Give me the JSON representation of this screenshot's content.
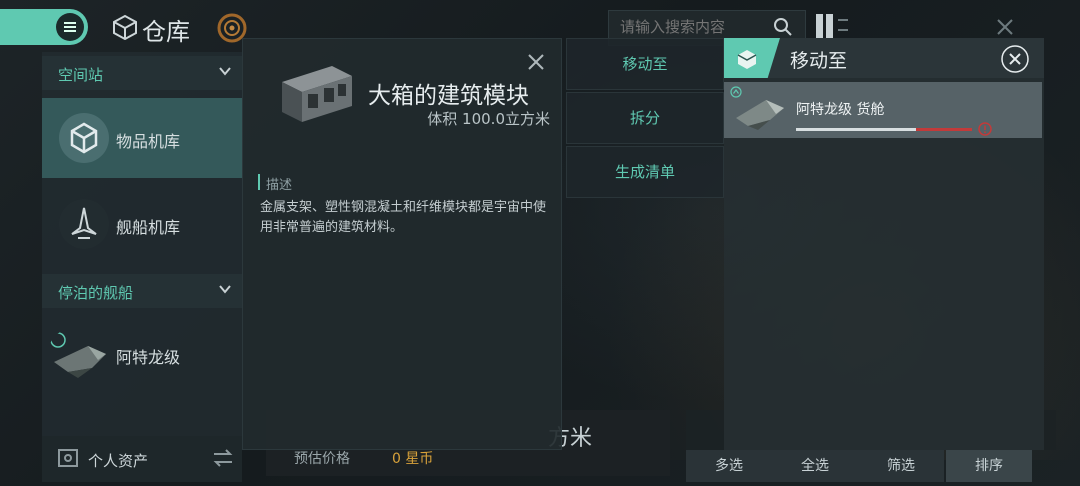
{
  "header": {
    "title": "仓库",
    "search_placeholder": "请输入搜索内容"
  },
  "sidebar": {
    "section_station": "空间站",
    "items": [
      {
        "label": "物品机库",
        "active": true
      },
      {
        "label": "舰船机库",
        "active": false
      }
    ],
    "section_docked": "停泊的舰船",
    "ship_label": "阿特龙级",
    "assets_label": "个人资产"
  },
  "detail": {
    "name": "大箱的建筑模块",
    "volume": "体积 100.0立方米",
    "desc_title": "描述",
    "desc_text": "金属支架、塑性钢混凝土和纤维模块都是宇宙中使用非常普遍的建筑材料。"
  },
  "actions": {
    "move": "移动至",
    "split": "拆分",
    "list": "生成清单"
  },
  "bottom": {
    "volume_fragment": "方米",
    "price_label": "预估价格",
    "price_value": "0 星币",
    "multi_select": "多选",
    "select_all": "全选",
    "filter": "筛选",
    "sort": "排序"
  },
  "moveto": {
    "title": "移动至",
    "target_name": "阿特龙级 货舱",
    "capacity_fill": 0.68
  },
  "colors": {
    "accent": "#5fc9b1",
    "price": "#d9a23a",
    "alert": "#c23a3a"
  },
  "icons": [
    "menu-icon",
    "cube-icon",
    "ring-icon",
    "search-icon",
    "layout-icon",
    "close-icon",
    "chevron-down-icon",
    "box-icon",
    "ship-icon",
    "asset-icon",
    "swap-icon",
    "alert-icon"
  ]
}
